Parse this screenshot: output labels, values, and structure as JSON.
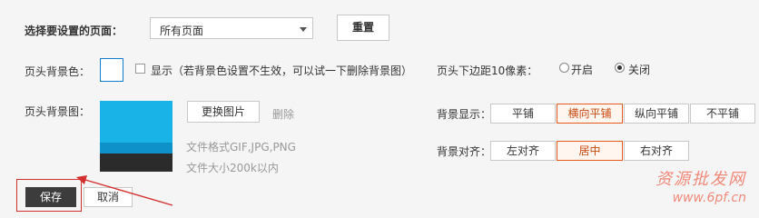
{
  "page": {
    "select_label": "选择要设置的页面：",
    "select_value": "所有页面",
    "reset_button": "重置"
  },
  "header_bg": {
    "color_label": "页头背景色：",
    "show_checkbox_text": "显示（若背景色设置不生效，可以试一下删除背景图）",
    "image_label": "页头背景图：",
    "change_image_button": "更换图片",
    "delete_link": "删除",
    "format_hint": "文件格式GIF,JPG,PNG",
    "size_hint": "文件大小200k以内"
  },
  "margin": {
    "label": "页头下边距10像素：",
    "option_on": "开启",
    "option_off": "关闭",
    "selected": "关闭"
  },
  "bg_display": {
    "label": "背景显示：",
    "options": [
      "平铺",
      "横向平铺",
      "纵向平铺",
      "不平铺"
    ],
    "selected": "横向平铺"
  },
  "bg_align": {
    "label": "背景对齐：",
    "options": [
      "左对齐",
      "居中",
      "右对齐"
    ],
    "selected": "居中"
  },
  "actions": {
    "save": "保存",
    "cancel": "取消"
  },
  "watermark": {
    "text": "资源批发网",
    "url": "www.6pf.cn"
  },
  "colors": {
    "accent": "#e85a1c",
    "preview_top": "#1ab3e8",
    "preview_mid": "#0e90c9",
    "preview_bottom": "#2b2b2b",
    "annotation": "#d32f2f"
  }
}
